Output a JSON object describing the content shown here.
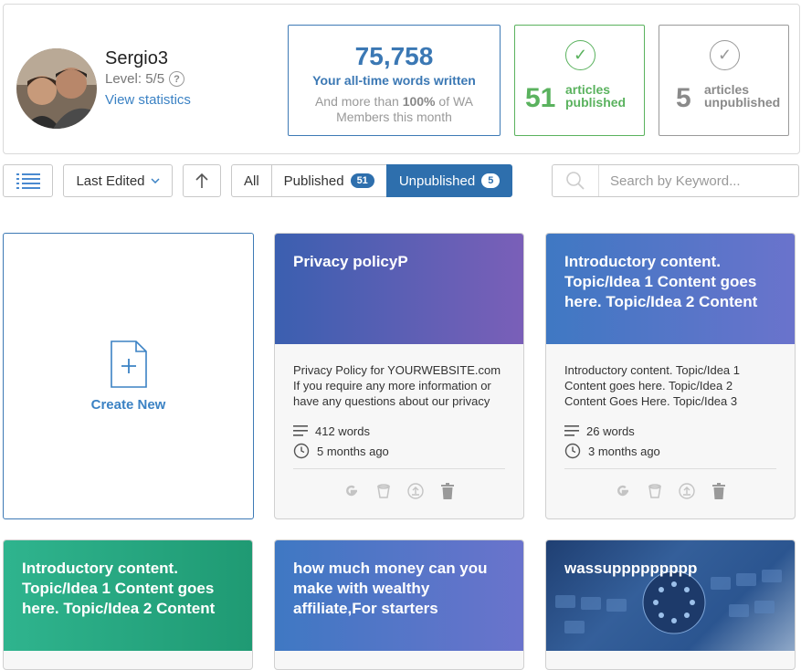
{
  "profile": {
    "username": "Sergio3",
    "level": "Level: 5/5",
    "help": "?",
    "view_statistics": "View statistics"
  },
  "words": {
    "count": "75,758",
    "label": "Your all-time words written",
    "sub_prefix": "And more than",
    "sub_bold": "100%",
    "sub_suffix": "of WA Members this month"
  },
  "published": {
    "count": "51",
    "label_line1": "articles",
    "label_line2": "published"
  },
  "unpublished": {
    "count": "5",
    "label_line1": "articles",
    "label_line2": "unpublished"
  },
  "toolbar": {
    "sort_label": "Last Edited",
    "filter_all": "All",
    "filter_published": "Published",
    "filter_published_count": "51",
    "filter_unpublished": "Unpublished",
    "filter_unpublished_count": "5",
    "search_placeholder": "Search by Keyword..."
  },
  "create_new": "Create New",
  "cards": [
    {
      "title": "Privacy policyP",
      "excerpt": "Privacy Policy for YOURWEBSITE.com If you require any more information or have any questions about our privacy",
      "words": "412 words",
      "time": "5 months ago"
    },
    {
      "title": "Introductory content. Topic/Idea 1 Content goes here. Topic/Idea 2 Content",
      "excerpt": "Introductory content.  Topic/Idea 1 Content goes here.  Topic/Idea 2 Content Goes Here. Topic/Idea 3",
      "words": "26 words",
      "time": "3 months ago"
    },
    {
      "title": "Introductory content. Topic/Idea 1 Content goes here. Topic/Idea 2 Content"
    },
    {
      "title": "how much money can you make with wealthy affiliate,For starters"
    },
    {
      "title": "wassuppppppppp"
    }
  ],
  "colors": {
    "accent": "#2e6fad",
    "published_green": "#5ab25e"
  }
}
